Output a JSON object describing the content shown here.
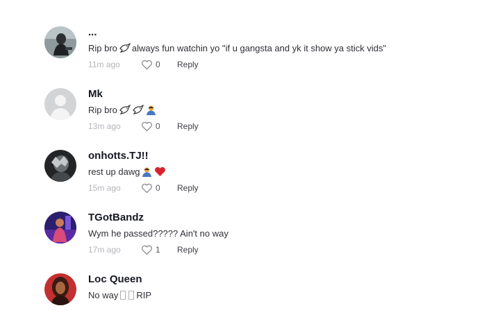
{
  "comments": [
    {
      "username": "...",
      "text": "Rip bro",
      "text_after": "always fun watchin yo \"if u gangsta and yk it show ya stick vids\"",
      "time": "11m ago",
      "likes": "0",
      "reply": "Reply"
    },
    {
      "username": "Mk",
      "text": "Rip bro",
      "time": "13m ago",
      "likes": "0",
      "reply": "Reply"
    },
    {
      "username": "onhotts.TJ!!",
      "text": "rest up dawg",
      "time": "15m ago",
      "likes": "0",
      "reply": "Reply"
    },
    {
      "username": "TGotBandz",
      "text": "Wym he passed????? Ain't no way",
      "time": "17m ago",
      "likes": "1",
      "reply": "Reply"
    },
    {
      "username": "Loc Queen",
      "text": "No way",
      "text_after": "RIP"
    }
  ],
  "colors": {
    "username": "#161823",
    "timestamp": "#b5b5bb",
    "heart_red": "#d8232f"
  }
}
